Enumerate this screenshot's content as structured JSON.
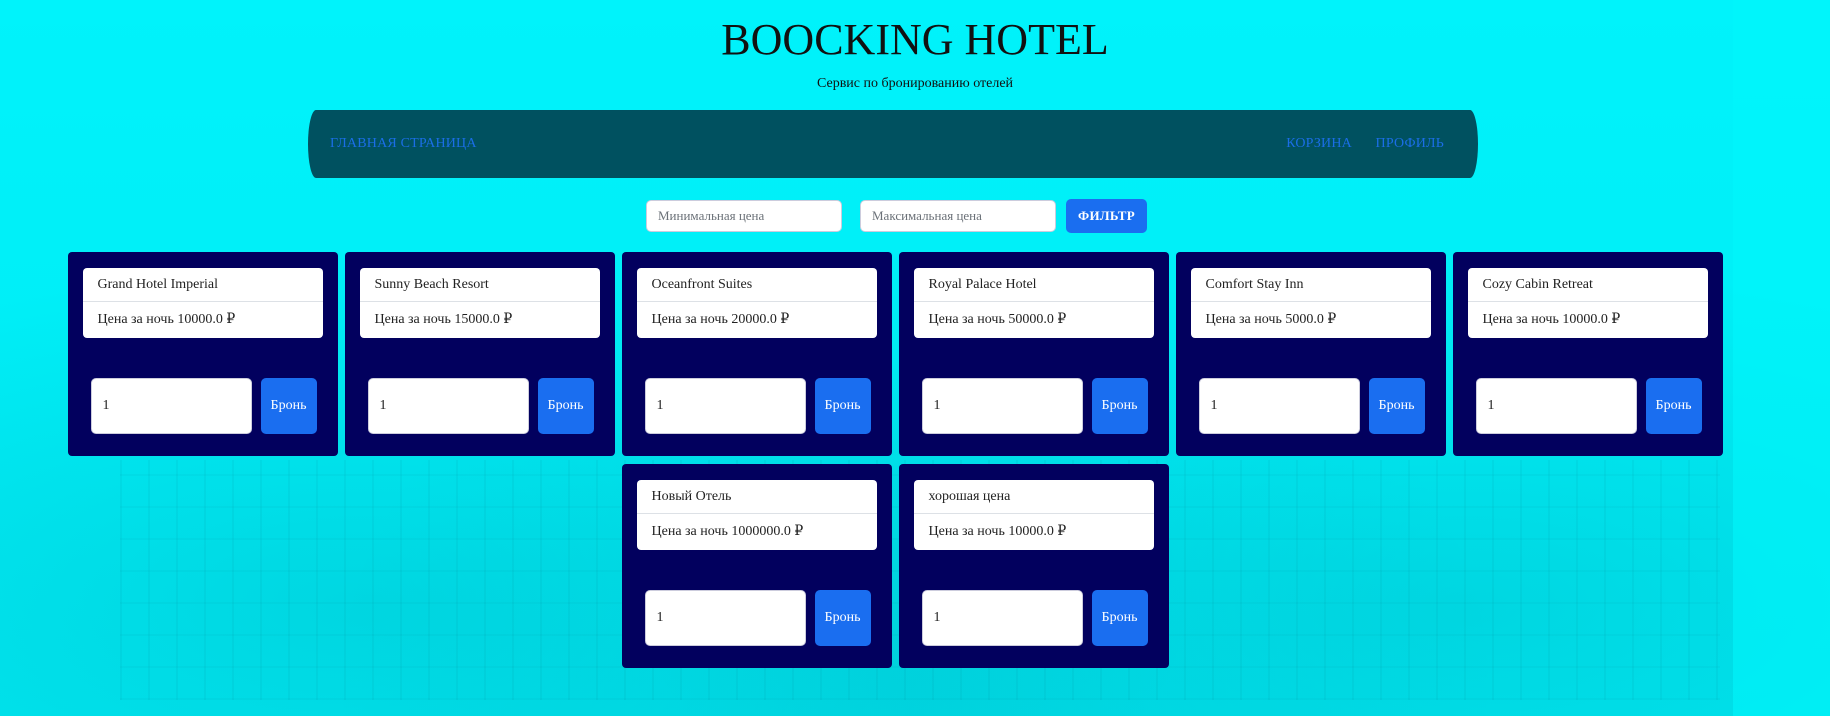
{
  "header": {
    "title": "BOOCKING HOTEL",
    "subtitle": "Сервис по бронированию отелей"
  },
  "nav": {
    "home": "ГЛАВНАЯ СТРАНИЦА",
    "cart": "КОРЗИНА",
    "profile": "ПРОФИЛЬ"
  },
  "filter": {
    "min_placeholder": "Минимальная цена",
    "max_placeholder": "Максимальная цена",
    "button": "ФИЛЬТР"
  },
  "hotels": [
    {
      "name": "Grand Hotel Imperial",
      "price": "Цена за ночь 10000.0 ₽",
      "qty": "1",
      "button": "Бронь"
    },
    {
      "name": "Sunny Beach Resort",
      "price": "Цена за ночь 15000.0 ₽",
      "qty": "1",
      "button": "Бронь"
    },
    {
      "name": "Oceanfront Suites",
      "price": "Цена за ночь 20000.0 ₽",
      "qty": "1",
      "button": "Бронь"
    },
    {
      "name": "Royal Palace Hotel",
      "price": "Цена за ночь 50000.0 ₽",
      "qty": "1",
      "button": "Бронь"
    },
    {
      "name": "Comfort Stay Inn",
      "price": "Цена за ночь 5000.0 ₽",
      "qty": "1",
      "button": "Бронь"
    },
    {
      "name": "Cozy Cabin Retreat",
      "price": "Цена за ночь 10000.0 ₽",
      "qty": "1",
      "button": "Бронь"
    },
    {
      "name": "Новый Отель",
      "price": "Цена за ночь 1000000.0 ₽",
      "qty": "1",
      "button": "Бронь"
    },
    {
      "name": "хорошая цена",
      "price": "Цена за ночь 10000.0 ₽",
      "qty": "1",
      "button": "Бронь"
    }
  ],
  "colors": {
    "background": "#00f3fb",
    "navbar": "#005160",
    "card": "#02005e",
    "accent": "#1a6ef0"
  }
}
